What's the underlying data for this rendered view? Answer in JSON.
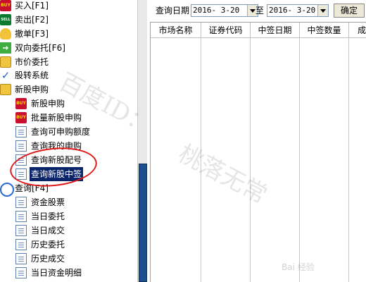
{
  "sidebar": {
    "items": [
      {
        "label": "买入[F1]",
        "icon": "buy-icon"
      },
      {
        "label": "卖出[F2]",
        "icon": "sell-icon"
      },
      {
        "label": "撤单[F3]",
        "icon": "hand-icon"
      },
      {
        "label": "双向委托[F6]",
        "icon": "swap-icon"
      },
      {
        "label": "市价委托",
        "icon": "folder-icon"
      },
      {
        "label": "股转系统",
        "icon": "check-icon"
      },
      {
        "label": "新股申购",
        "icon": "folder-icon"
      },
      {
        "label": "新股申购",
        "icon": "buy-icon"
      },
      {
        "label": "批量新股申购",
        "icon": "buy-icon"
      },
      {
        "label": "查询可申购额度",
        "icon": "document-icon"
      },
      {
        "label": "查询我的申购",
        "icon": "document-icon"
      },
      {
        "label": "查询新股配号",
        "icon": "document-icon"
      },
      {
        "label": "查询新股中签",
        "icon": "document-icon",
        "selected": true
      },
      {
        "label": "查询[F4]",
        "icon": "search-icon"
      },
      {
        "label": "资金股票",
        "icon": "document-icon"
      },
      {
        "label": "当日委托",
        "icon": "document-icon"
      },
      {
        "label": "当日成交",
        "icon": "document-icon"
      },
      {
        "label": "历史委托",
        "icon": "document-icon"
      },
      {
        "label": "历史成交",
        "icon": "document-icon"
      },
      {
        "label": "当日资金明细",
        "icon": "document-icon"
      }
    ]
  },
  "toolbar": {
    "query_date_label": "查询日期",
    "start_date": "2016- 3-20",
    "to_label": "至",
    "end_date": "2016- 3-20",
    "confirm_label": "确定"
  },
  "table": {
    "columns": [
      "市场名称",
      "证券代码",
      "中签日期",
      "中签数量",
      "成交"
    ]
  },
  "watermark": {
    "text_1": "百度ID：",
    "text_2": "桃落无常",
    "logo": "Bai 经验"
  },
  "colors": {
    "selected_bg": "#0a246a",
    "annotation_circle": "#e01818",
    "scroll_thumb": "#1c4f8e"
  }
}
